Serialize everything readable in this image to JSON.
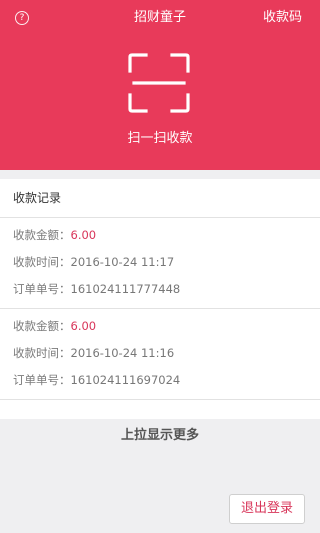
{
  "header": {
    "title": "招财童子",
    "help_glyph": "?",
    "collect_code_label": "收款码",
    "scan_label": "扫一扫收款",
    "bg_color": "#e83a5a"
  },
  "records": {
    "title": "收款记录",
    "items": [
      {
        "amount_label": "收款金额：",
        "amount": "6.00",
        "time_label": "收款时间：",
        "time": "2016-10-24 11:17",
        "order_label": "订单单号：",
        "order": "161024111777448"
      },
      {
        "amount_label": "收款金额：",
        "amount": "6.00",
        "time_label": "收款时间：",
        "time": "2016-10-24 11:16",
        "order_label": "订单单号：",
        "order": "161024111697024"
      }
    ]
  },
  "pull_more_label": "上拉显示更多",
  "logout_label": "退出登录",
  "icons": {
    "help": "help-circle-icon",
    "scan": "scan-frame-icon"
  }
}
